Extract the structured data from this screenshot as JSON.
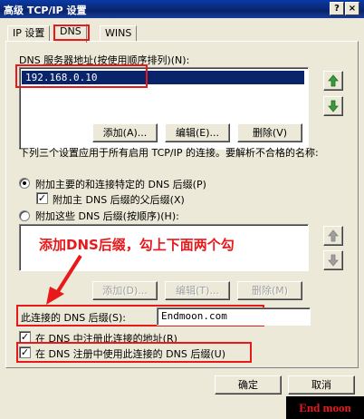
{
  "window": {
    "title": "高级 TCP/IP 设置",
    "help_btn": "?",
    "close_btn": "×"
  },
  "tabs": [
    {
      "label": "IP 设置"
    },
    {
      "label": "DNS"
    },
    {
      "label": "WINS"
    }
  ],
  "dns_servers": {
    "label": "DNS 服务器地址(按使用顺序排列)(N):",
    "items": [
      "192.168.0.10"
    ],
    "add": "添加(A)...",
    "edit": "编辑(E)...",
    "remove": "删除(V)"
  },
  "resolution": {
    "description": "下列三个设置应用于所有启用 TCP/IP 的连接。要解析不合格的名称:",
    "opt_primary": "附加主要的和连接特定的 DNS 后缀(P)",
    "opt_parent": "附加主 DNS 后缀的父后缀(X)",
    "opt_these": "附加这些 DNS 后缀(按顺序)(H):",
    "add": "添加(D)...",
    "edit": "编辑(T)...",
    "remove": "删除(M)"
  },
  "annotation": "添加DNS后缀，勾上下面两个勾",
  "suffix": {
    "label": "此连接的 DNS 后缀(S):",
    "value": "Endmoon.com"
  },
  "register": {
    "reg_address": "在 DNS 中注册此连接的地址(R)",
    "use_suffix": "在 DNS 注册中使用此连接的 DNS 后缀(U)"
  },
  "footer": {
    "ok": "确定",
    "cancel": "取消"
  },
  "watermark": "End moon",
  "colors": {
    "annotation_red": "#e8181b",
    "titlebar": "#0a246a",
    "selection": "#0a246a"
  }
}
